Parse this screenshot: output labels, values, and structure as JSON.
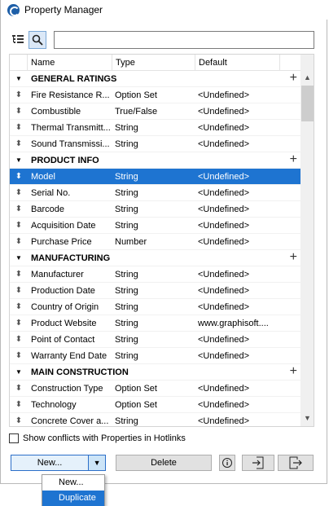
{
  "window": {
    "title": "Property Manager",
    "accent": "#1e74d1"
  },
  "toolbar": {
    "tree_icon": "tree-view-icon",
    "search_icon": "search-icon",
    "search_placeholder": ""
  },
  "columns": {
    "name": "Name",
    "type": "Type",
    "default": "Default"
  },
  "groups": [
    {
      "label": "GENERAL RATINGS",
      "rows": [
        {
          "name": "Fire Resistance R...",
          "type": "Option Set",
          "default": "<Undefined>"
        },
        {
          "name": "Combustible",
          "type": "True/False",
          "default": "<Undefined>"
        },
        {
          "name": "Thermal Transmitt...",
          "type": "String",
          "default": "<Undefined>"
        },
        {
          "name": "Sound Transmissi...",
          "type": "String",
          "default": "<Undefined>"
        }
      ]
    },
    {
      "label": "PRODUCT INFO",
      "rows": [
        {
          "name": "Model",
          "type": "String",
          "default": "<Undefined>",
          "selected": true
        },
        {
          "name": "Serial No.",
          "type": "String",
          "default": "<Undefined>"
        },
        {
          "name": "Barcode",
          "type": "String",
          "default": "<Undefined>"
        },
        {
          "name": "Acquisition Date",
          "type": "String",
          "default": "<Undefined>"
        },
        {
          "name": "Purchase Price",
          "type": "Number",
          "default": "<Undefined>"
        }
      ]
    },
    {
      "label": "MANUFACTURING",
      "rows": [
        {
          "name": "Manufacturer",
          "type": "String",
          "default": "<Undefined>"
        },
        {
          "name": "Production Date",
          "type": "String",
          "default": "<Undefined>"
        },
        {
          "name": "Country of Origin",
          "type": "String",
          "default": "<Undefined>"
        },
        {
          "name": "Product Website",
          "type": "String",
          "default": "www.graphisoft...."
        },
        {
          "name": "Point of Contact",
          "type": "String",
          "default": "<Undefined>"
        },
        {
          "name": "Warranty End Date",
          "type": "String",
          "default": "<Undefined>"
        }
      ]
    },
    {
      "label": "MAIN CONSTRUCTION",
      "rows": [
        {
          "name": "Construction Type",
          "type": "Option Set",
          "default": "<Undefined>"
        },
        {
          "name": "Technology",
          "type": "Option Set",
          "default": "<Undefined>"
        },
        {
          "name": "Concrete Cover a...",
          "type": "String",
          "default": "<Undefined>"
        }
      ]
    }
  ],
  "conflict_label": "Show conflicts with Properties in Hotlinks",
  "buttons": {
    "new": "New...",
    "delete": "Delete",
    "info": "i"
  },
  "dropdown": {
    "items": [
      "New...",
      "Duplicate"
    ],
    "selected_index": 1
  }
}
